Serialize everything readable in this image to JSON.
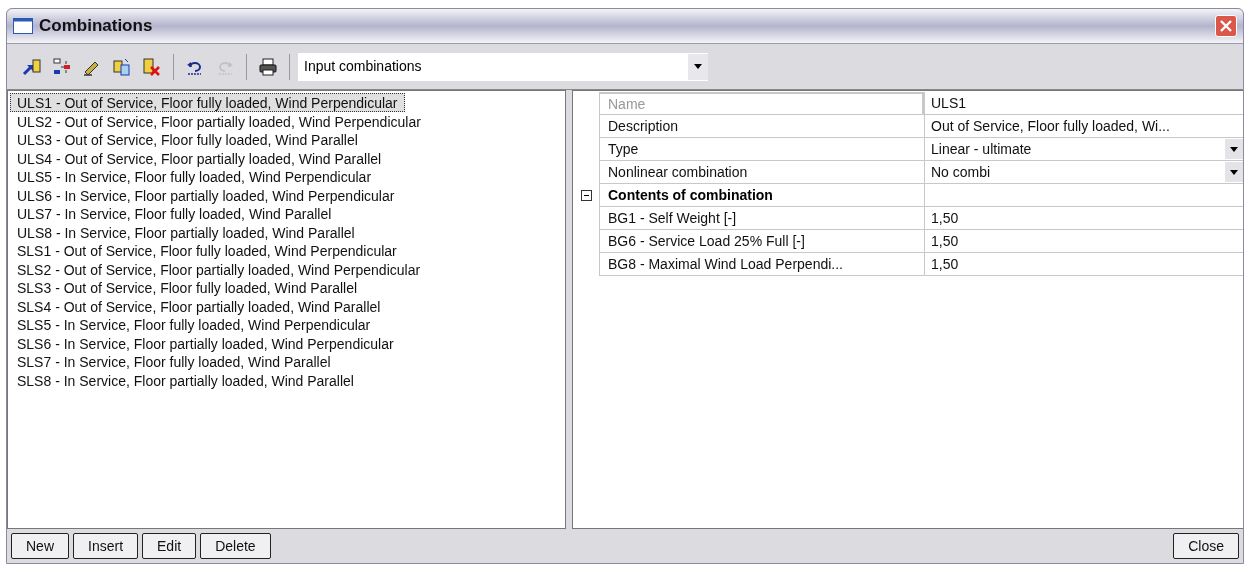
{
  "window": {
    "title": "Combinations"
  },
  "toolbar": {
    "groups": [
      [
        {
          "kind": "insert",
          "disabled": false
        },
        {
          "kind": "move",
          "disabled": false
        },
        {
          "kind": "pencil",
          "disabled": false
        },
        {
          "kind": "copy",
          "disabled": false
        },
        {
          "kind": "delete",
          "disabled": false
        }
      ],
      [
        {
          "kind": "undo",
          "disabled": false
        },
        {
          "kind": "redo",
          "disabled": true
        }
      ],
      [
        {
          "kind": "print",
          "disabled": false
        }
      ]
    ],
    "dropdown": {
      "value": "Input combinations"
    }
  },
  "list": {
    "items": [
      {
        "label": "ULS1 - Out of Service, Floor fully loaded, Wind Perpendicular",
        "selected": true
      },
      {
        "label": "ULS2 - Out of Service, Floor partially loaded, Wind Perpendicular",
        "selected": false
      },
      {
        "label": "ULS3 - Out of Service, Floor fully loaded, Wind Parallel",
        "selected": false
      },
      {
        "label": "ULS4 - Out of Service, Floor partially loaded, Wind Parallel",
        "selected": false
      },
      {
        "label": "ULS5 - In Service, Floor fully loaded, Wind Perpendicular",
        "selected": false
      },
      {
        "label": "ULS6 - In Service, Floor partially loaded, Wind Perpendicular",
        "selected": false
      },
      {
        "label": "ULS7 - In Service, Floor fully loaded, Wind Parallel",
        "selected": false
      },
      {
        "label": "ULS8 - In Service, Floor partially loaded, Wind Parallel",
        "selected": false
      },
      {
        "label": "SLS1 - Out of Service, Floor fully loaded, Wind Perpendicular",
        "selected": false
      },
      {
        "label": "SLS2 - Out of Service, Floor partially loaded, Wind Perpendicular",
        "selected": false
      },
      {
        "label": "SLS3 - Out of Service, Floor fully loaded, Wind Parallel",
        "selected": false
      },
      {
        "label": "SLS4 - Out of Service, Floor partially loaded, Wind Parallel",
        "selected": false
      },
      {
        "label": "SLS5 - In Service, Floor fully loaded, Wind Perpendicular",
        "selected": false
      },
      {
        "label": "SLS6 - In Service, Floor partially loaded, Wind Perpendicular",
        "selected": false
      },
      {
        "label": "SLS7 - In Service, Floor fully loaded, Wind Parallel",
        "selected": false
      },
      {
        "label": "SLS8 - In Service, Floor partially loaded, Wind Parallel",
        "selected": false
      }
    ]
  },
  "properties": {
    "rows": [
      {
        "kind": "text",
        "label": "Name",
        "value": "ULS1",
        "disabled": true
      },
      {
        "kind": "text",
        "label": "Description",
        "value": "Out of Service, Floor fully loaded, Wi...",
        "disabled": false
      },
      {
        "kind": "dropdown",
        "label": "Type",
        "value": "Linear - ultimate",
        "disabled": false
      },
      {
        "kind": "dropdown",
        "label": "Nonlinear combination",
        "value": "No combi",
        "disabled": false
      },
      {
        "kind": "section",
        "label": "Contents of combination",
        "expanded": true,
        "children": [
          {
            "kind": "text",
            "label": "BG1 - Self Weight [-]",
            "value": "1,50",
            "disabled": false
          },
          {
            "kind": "text",
            "label": "BG6 - Service Load 25% Full [-]",
            "value": "1,50",
            "disabled": false
          },
          {
            "kind": "text",
            "label": "BG8 - Maximal Wind Load Perpendi...",
            "value": "1,50",
            "disabled": false
          }
        ]
      }
    ]
  },
  "buttons": {
    "left": [
      "New",
      "Insert",
      "Edit",
      "Delete"
    ],
    "right": [
      "Close"
    ]
  }
}
